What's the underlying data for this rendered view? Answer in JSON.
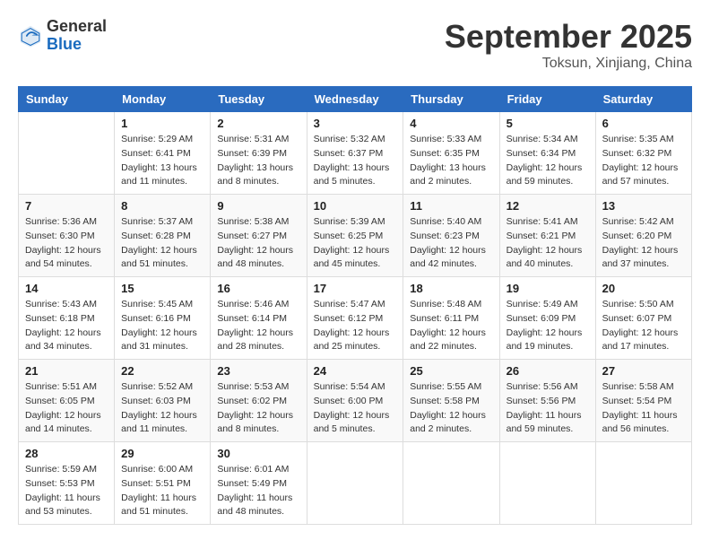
{
  "logo": {
    "general": "General",
    "blue": "Blue"
  },
  "title": "September 2025",
  "location": "Toksun, Xinjiang, China",
  "days_header": [
    "Sunday",
    "Monday",
    "Tuesday",
    "Wednesday",
    "Thursday",
    "Friday",
    "Saturday"
  ],
  "weeks": [
    [
      {
        "day": "",
        "info": ""
      },
      {
        "day": "1",
        "info": "Sunrise: 5:29 AM\nSunset: 6:41 PM\nDaylight: 13 hours\nand 11 minutes."
      },
      {
        "day": "2",
        "info": "Sunrise: 5:31 AM\nSunset: 6:39 PM\nDaylight: 13 hours\nand 8 minutes."
      },
      {
        "day": "3",
        "info": "Sunrise: 5:32 AM\nSunset: 6:37 PM\nDaylight: 13 hours\nand 5 minutes."
      },
      {
        "day": "4",
        "info": "Sunrise: 5:33 AM\nSunset: 6:35 PM\nDaylight: 13 hours\nand 2 minutes."
      },
      {
        "day": "5",
        "info": "Sunrise: 5:34 AM\nSunset: 6:34 PM\nDaylight: 12 hours\nand 59 minutes."
      },
      {
        "day": "6",
        "info": "Sunrise: 5:35 AM\nSunset: 6:32 PM\nDaylight: 12 hours\nand 57 minutes."
      }
    ],
    [
      {
        "day": "7",
        "info": "Sunrise: 5:36 AM\nSunset: 6:30 PM\nDaylight: 12 hours\nand 54 minutes."
      },
      {
        "day": "8",
        "info": "Sunrise: 5:37 AM\nSunset: 6:28 PM\nDaylight: 12 hours\nand 51 minutes."
      },
      {
        "day": "9",
        "info": "Sunrise: 5:38 AM\nSunset: 6:27 PM\nDaylight: 12 hours\nand 48 minutes."
      },
      {
        "day": "10",
        "info": "Sunrise: 5:39 AM\nSunset: 6:25 PM\nDaylight: 12 hours\nand 45 minutes."
      },
      {
        "day": "11",
        "info": "Sunrise: 5:40 AM\nSunset: 6:23 PM\nDaylight: 12 hours\nand 42 minutes."
      },
      {
        "day": "12",
        "info": "Sunrise: 5:41 AM\nSunset: 6:21 PM\nDaylight: 12 hours\nand 40 minutes."
      },
      {
        "day": "13",
        "info": "Sunrise: 5:42 AM\nSunset: 6:20 PM\nDaylight: 12 hours\nand 37 minutes."
      }
    ],
    [
      {
        "day": "14",
        "info": "Sunrise: 5:43 AM\nSunset: 6:18 PM\nDaylight: 12 hours\nand 34 minutes."
      },
      {
        "day": "15",
        "info": "Sunrise: 5:45 AM\nSunset: 6:16 PM\nDaylight: 12 hours\nand 31 minutes."
      },
      {
        "day": "16",
        "info": "Sunrise: 5:46 AM\nSunset: 6:14 PM\nDaylight: 12 hours\nand 28 minutes."
      },
      {
        "day": "17",
        "info": "Sunrise: 5:47 AM\nSunset: 6:12 PM\nDaylight: 12 hours\nand 25 minutes."
      },
      {
        "day": "18",
        "info": "Sunrise: 5:48 AM\nSunset: 6:11 PM\nDaylight: 12 hours\nand 22 minutes."
      },
      {
        "day": "19",
        "info": "Sunrise: 5:49 AM\nSunset: 6:09 PM\nDaylight: 12 hours\nand 19 minutes."
      },
      {
        "day": "20",
        "info": "Sunrise: 5:50 AM\nSunset: 6:07 PM\nDaylight: 12 hours\nand 17 minutes."
      }
    ],
    [
      {
        "day": "21",
        "info": "Sunrise: 5:51 AM\nSunset: 6:05 PM\nDaylight: 12 hours\nand 14 minutes."
      },
      {
        "day": "22",
        "info": "Sunrise: 5:52 AM\nSunset: 6:03 PM\nDaylight: 12 hours\nand 11 minutes."
      },
      {
        "day": "23",
        "info": "Sunrise: 5:53 AM\nSunset: 6:02 PM\nDaylight: 12 hours\nand 8 minutes."
      },
      {
        "day": "24",
        "info": "Sunrise: 5:54 AM\nSunset: 6:00 PM\nDaylight: 12 hours\nand 5 minutes."
      },
      {
        "day": "25",
        "info": "Sunrise: 5:55 AM\nSunset: 5:58 PM\nDaylight: 12 hours\nand 2 minutes."
      },
      {
        "day": "26",
        "info": "Sunrise: 5:56 AM\nSunset: 5:56 PM\nDaylight: 11 hours\nand 59 minutes."
      },
      {
        "day": "27",
        "info": "Sunrise: 5:58 AM\nSunset: 5:54 PM\nDaylight: 11 hours\nand 56 minutes."
      }
    ],
    [
      {
        "day": "28",
        "info": "Sunrise: 5:59 AM\nSunset: 5:53 PM\nDaylight: 11 hours\nand 53 minutes."
      },
      {
        "day": "29",
        "info": "Sunrise: 6:00 AM\nSunset: 5:51 PM\nDaylight: 11 hours\nand 51 minutes."
      },
      {
        "day": "30",
        "info": "Sunrise: 6:01 AM\nSunset: 5:49 PM\nDaylight: 11 hours\nand 48 minutes."
      },
      {
        "day": "",
        "info": ""
      },
      {
        "day": "",
        "info": ""
      },
      {
        "day": "",
        "info": ""
      },
      {
        "day": "",
        "info": ""
      }
    ]
  ]
}
